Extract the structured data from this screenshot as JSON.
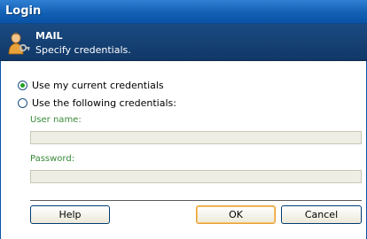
{
  "window": {
    "title": "Login"
  },
  "header": {
    "title": "MAIL",
    "subtitle": "Specify credentials.",
    "icon": "user-key-icon"
  },
  "credentials": {
    "option_current": "Use my current credentials",
    "option_following": "Use the following credentials:",
    "selected": "current",
    "username_label": "User name:",
    "username_value": "",
    "password_label": "Password:",
    "password_value": ""
  },
  "buttons": {
    "help": "Help",
    "ok": "OK",
    "cancel": "Cancel"
  },
  "colors": {
    "title_bar": "#1261b5",
    "header_band": "#113867",
    "field_label": "#3a8a3a",
    "default_button_border": "#e8a03a"
  }
}
